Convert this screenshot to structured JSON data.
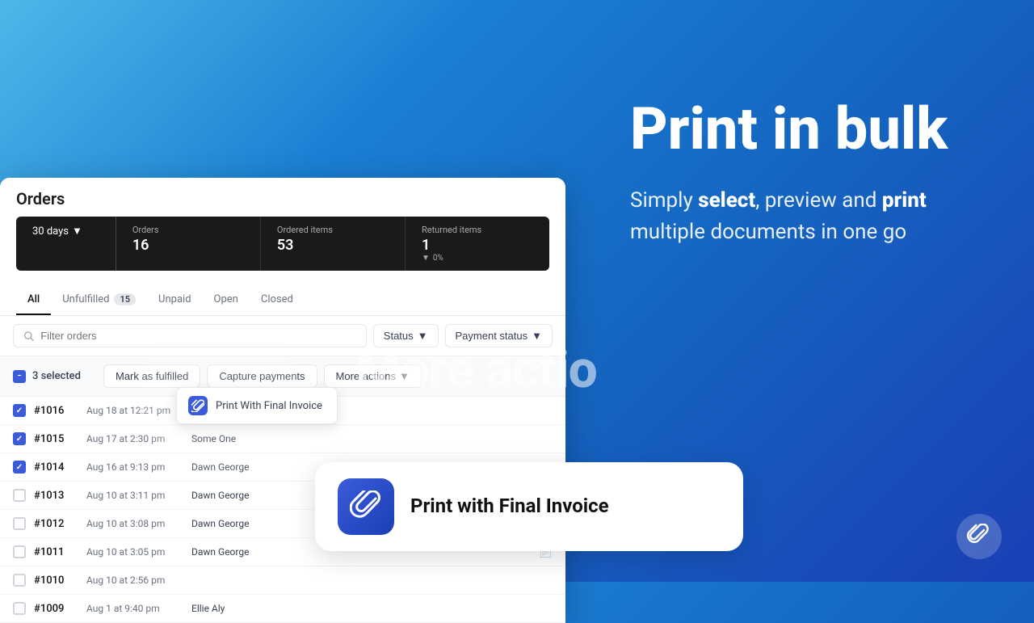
{
  "headline": "Print in bulk",
  "subtext_before": "Simply ",
  "subtext_select": "select",
  "subtext_mid": ", preview and ",
  "subtext_print": "print",
  "subtext_after": " multiple documents in one go",
  "orders": {
    "title": "Orders",
    "stats": {
      "days_label": "30 days",
      "orders_label": "Orders",
      "orders_value": "16",
      "ordered_items_label": "Ordered items",
      "ordered_items_value": "53",
      "returned_items_label": "Returned items",
      "returned_items_value": "1",
      "returned_pct": "0%"
    },
    "tabs": [
      {
        "label": "All",
        "active": true
      },
      {
        "label": "Unfulfilled",
        "badge": "15"
      },
      {
        "label": "Unpaid"
      },
      {
        "label": "Open"
      },
      {
        "label": "Closed"
      }
    ],
    "search_placeholder": "Filter orders",
    "filters": [
      {
        "label": "Status"
      },
      {
        "label": "Payment status"
      }
    ],
    "action_bar": {
      "selected": "3 selected",
      "mark_fulfilled": "Mark as fulfilled",
      "capture_payments": "Capture payments",
      "more_actions": "More actions"
    },
    "dropdown": {
      "item_label": "Print With Final Invoice"
    },
    "rows": [
      {
        "num": "#1016",
        "date": "Aug 18 at 12:21 pm",
        "customer": "",
        "checked": true
      },
      {
        "num": "#1015",
        "date": "Aug 17 at 2:30 pm",
        "customer": "Some One",
        "checked": true
      },
      {
        "num": "#1014",
        "date": "Aug 16 at 9:13 pm",
        "customer": "Dawn George",
        "checked": true
      },
      {
        "num": "#1013",
        "date": "Aug 10 at 3:11 pm",
        "customer": "Dawn George",
        "checked": false
      },
      {
        "num": "#1012",
        "date": "Aug 10 at 3:08 pm",
        "customer": "Dawn George",
        "checked": false
      },
      {
        "num": "#1011",
        "date": "Aug 10 at 3:05 pm",
        "customer": "Dawn George",
        "checked": false
      },
      {
        "num": "#1010",
        "date": "Aug 10 at 2:56 pm",
        "customer": "",
        "checked": false
      },
      {
        "num": "#1009",
        "date": "Aug 1 at 9:40 pm",
        "customer": "Ellie Aly",
        "checked": false
      }
    ]
  },
  "more_actions_large": "More actio",
  "feature_card": {
    "label": "Print with Final Invoice"
  }
}
